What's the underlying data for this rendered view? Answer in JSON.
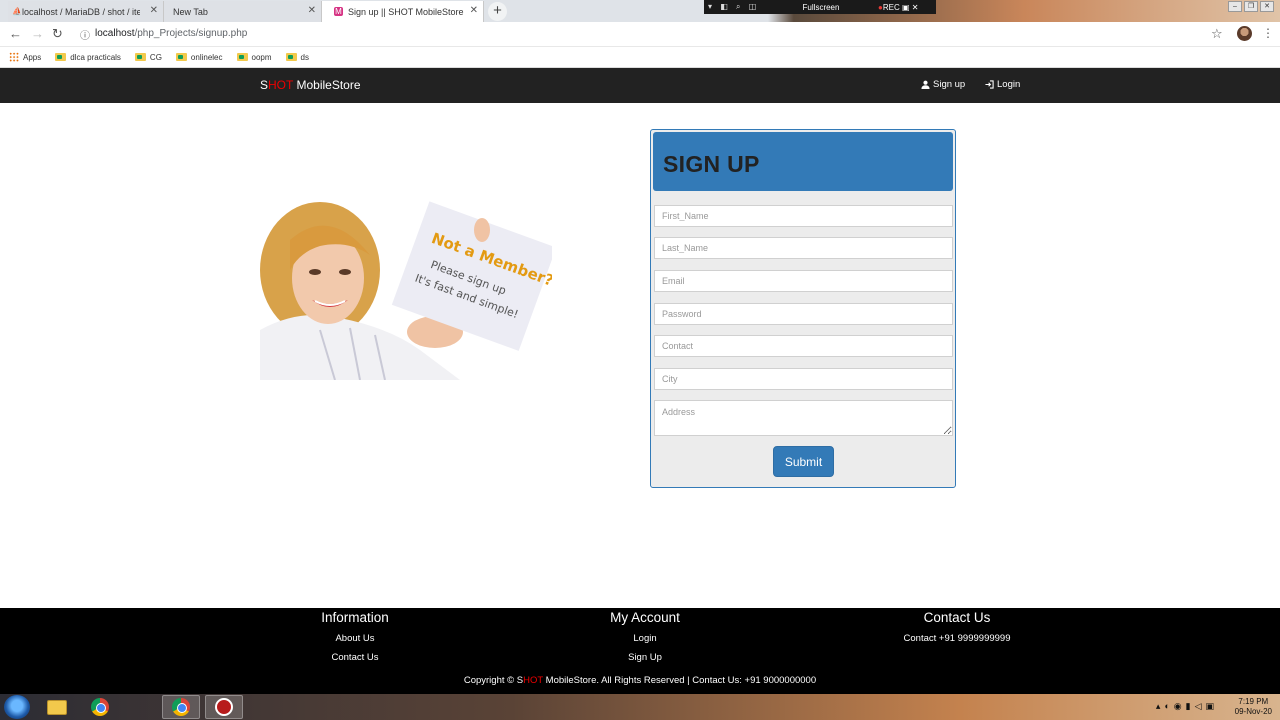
{
  "browser": {
    "tabs": [
      {
        "title": "localhost / MariaDB / shot / item",
        "active": false
      },
      {
        "title": "New Tab",
        "active": false
      },
      {
        "title": "Sign up || SHOT MobileStore",
        "active": true
      }
    ],
    "recorder": {
      "title": "Fullscreen",
      "rec_label": "REC"
    },
    "url_host": "localhost",
    "url_path": "/php_Projects/signup.php",
    "bookmarks": [
      "Apps",
      "dlca practicals",
      "CG",
      "onlinelec",
      "oopm",
      "ds"
    ]
  },
  "navbar": {
    "brand_prefix": "S",
    "brand_red": "HOT",
    "brand_suffix": " MobileStore",
    "links": [
      {
        "label": "Sign up",
        "icon": "user-icon"
      },
      {
        "label": "Login",
        "icon": "login-icon"
      }
    ]
  },
  "promo": {
    "card_line1": "Not a Member?",
    "card_line2": "Please sign up",
    "card_line3": "It's fast and simple!"
  },
  "signup_form": {
    "title": "SIGN UP",
    "fields": [
      {
        "placeholder": "First_Name",
        "value": ""
      },
      {
        "placeholder": "Last_Name",
        "value": ""
      },
      {
        "placeholder": "Email",
        "value": ""
      },
      {
        "placeholder": "Password",
        "value": ""
      },
      {
        "placeholder": "Contact",
        "value": ""
      },
      {
        "placeholder": "City",
        "value": ""
      },
      {
        "placeholder": "Address",
        "value": ""
      }
    ],
    "submit_label": "Submit"
  },
  "footer": {
    "columns": [
      {
        "heading": "Information",
        "links": [
          "About Us",
          "Contact Us"
        ]
      },
      {
        "heading": "My Account",
        "links": [
          "Login",
          "Sign Up"
        ]
      },
      {
        "heading": "Contact Us",
        "links": [
          "Contact +91 9999999999"
        ]
      }
    ],
    "copyright_prefix": "Copyright © S",
    "copyright_red": "HOT",
    "copyright_suffix": " MobileStore. All Rights Reserved | Contact Us: +91 9000000000"
  },
  "taskbar": {
    "clock_time": "7:19 PM",
    "clock_date": "09-Nov-20"
  },
  "colors": {
    "navbar_bg": "#222222",
    "primary": "#337ab7",
    "brand_red": "#ee0000",
    "footer_bg": "#000000"
  }
}
